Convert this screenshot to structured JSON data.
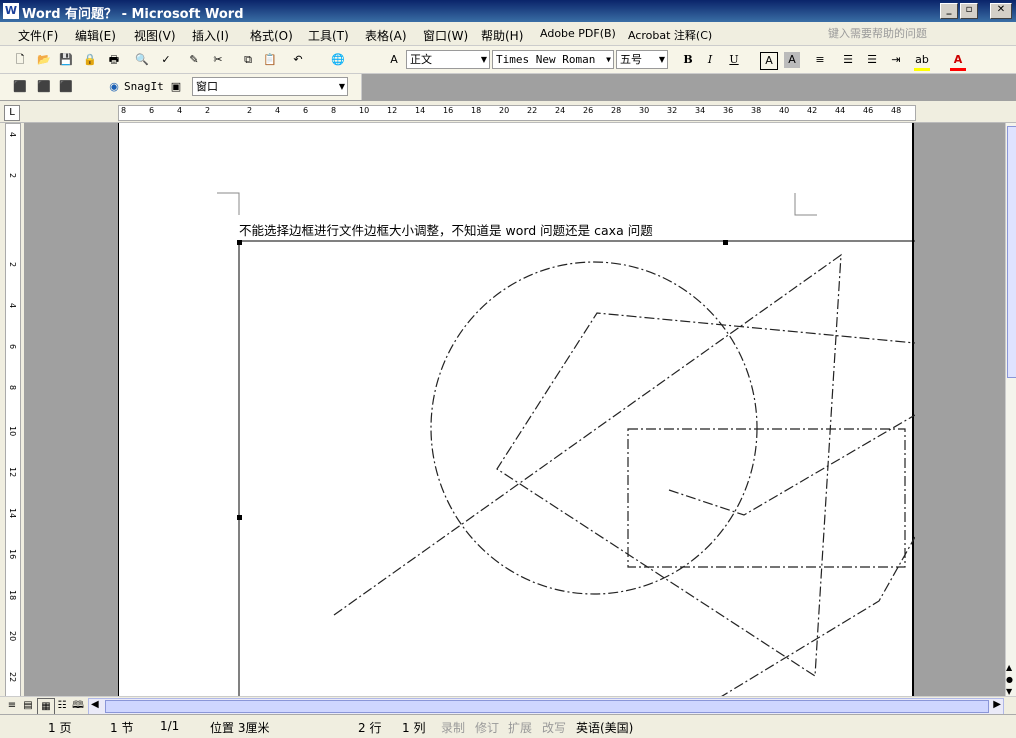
{
  "window": {
    "title": "Word 有问题？ - Microsoft Word",
    "app_icon": "W"
  },
  "menubar": {
    "items": [
      "文件(F)",
      "编辑(E)",
      "视图(V)",
      "插入(I)",
      "格式(O)",
      "工具(T)",
      "表格(A)",
      "窗口(W)",
      "帮助(H)",
      "Adobe PDF(B)",
      "Acrobat 注释(C)"
    ],
    "help_placeholder": "键入需要帮助的问题"
  },
  "toolbar": {
    "style": "正文",
    "font": "Times New Roman",
    "size": "五号",
    "bold": "B",
    "italic": "I",
    "underline": "U",
    "font_color_glyph": "A"
  },
  "toolbar2": {
    "snagit": "SnagIt",
    "window_combo": "窗口"
  },
  "ruler": {
    "h_ticks": [
      "8",
      "6",
      "4",
      "2",
      "2",
      "4",
      "6",
      "8",
      "10",
      "12",
      "14",
      "16",
      "18",
      "20",
      "22",
      "24",
      "26",
      "28",
      "30",
      "32",
      "34",
      "36",
      "38",
      "40",
      "42",
      "44",
      "46",
      "48"
    ],
    "v_ticks": [
      "4",
      "2",
      "2",
      "4",
      "6",
      "8",
      "10",
      "12",
      "14",
      "16",
      "18",
      "20",
      "22"
    ]
  },
  "document": {
    "text": "不能选择边框进行文件边框大小调整，不知道是 word 问题还是 caxa 问题"
  },
  "statusbar": {
    "page": "1 页",
    "section": "1 节",
    "pages": "1/1",
    "position": "位置 3厘米",
    "line": "2 行",
    "column": "1 列",
    "rec": "录制",
    "trk": "修订",
    "ext": "扩展",
    "ovr": "改写",
    "language": "英语(美国)"
  },
  "colors": {
    "titlebar": "#0a246a",
    "highlight": "#ffff00",
    "font_color": "#ff0000"
  }
}
